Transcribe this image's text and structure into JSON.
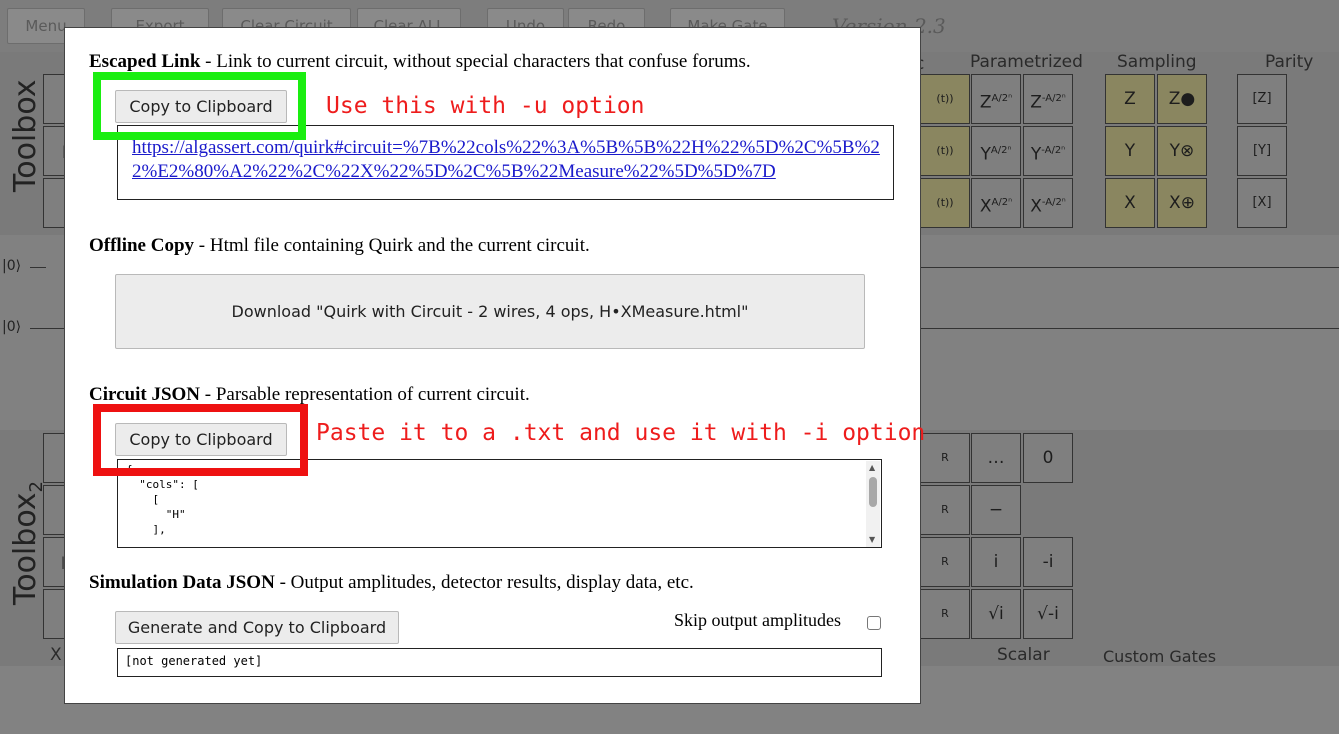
{
  "app": {
    "menu_buttons": [
      "Menu",
      "Export",
      "Clear Circuit",
      "Clear ALL",
      "Undo",
      "Redo",
      "Make Gate"
    ],
    "version": "Version 2.3",
    "toolbox_label": "Toolbox",
    "toolbox2_label": "Toolbox",
    "toolbox2_subscript": "2",
    "categories": {
      "parametrized": "Parametrized",
      "sampling": "Sampling",
      "parity": "Parity",
      "scalar": "Scalar",
      "custom_gates": "Custom Gates"
    },
    "wire_labels": [
      "|0⟩",
      "|0⟩"
    ],
    "scalar_gates": [
      "…",
      "0",
      "−",
      "i",
      "-i",
      "√i",
      "√-i"
    ]
  },
  "modal": {
    "escaped_link": {
      "title": "Escaped Link",
      "description": " - Link to current circuit, without special characters that confuse forums.",
      "button": "Copy to Clipboard",
      "url": "https://algassert.com/quirk#circuit=%7B%22cols%22%3A%5B%5B%22H%22%5D%2C%5B%22%E2%80%A2%22%2C%22X%22%5D%2C%5B%22Measure%22%5D%5D%7D"
    },
    "offline_copy": {
      "title": "Offline Copy",
      "description": " - Html file containing Quirk and the current circuit.",
      "button": "Download \"Quirk with Circuit - 2 wires, 4 ops, H•XMeasure.html\""
    },
    "circuit_json": {
      "title": "Circuit JSON",
      "description": " - Parsable representation of current circuit.",
      "button": "Copy to Clipboard",
      "json_preview": "{\n  \"cols\": [\n    [\n      \"H\"\n    ],"
    },
    "simulation": {
      "title": "Simulation Data JSON",
      "description": " - Output amplitudes, detector results, display data, etc.",
      "button": "Generate and Copy to Clipboard",
      "skip_label": "Skip output amplitudes",
      "skip_checked": false,
      "output": "[not generated yet]"
    }
  },
  "annotations": {
    "green_note": "Use this with -u option",
    "red_note": "Paste it to a .txt and use it with -i option",
    "green_color": "#1aee10",
    "red_color": "#ee1111"
  }
}
